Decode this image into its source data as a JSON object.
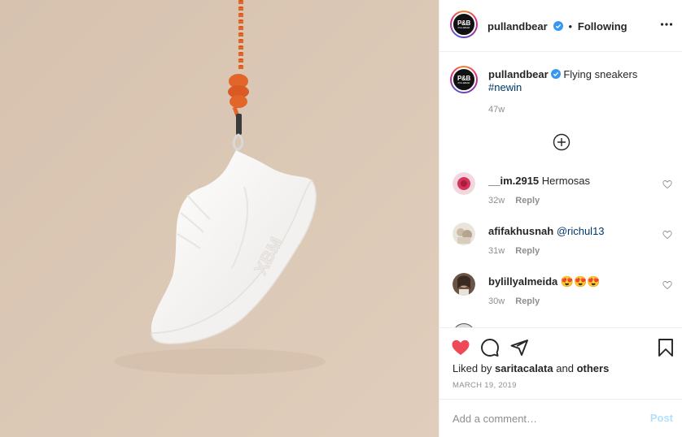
{
  "colors": {
    "photo_background": "#dcc9b7",
    "rope": "#e2662a",
    "verified_badge": "#3897f0",
    "like_heart": "#ed4956",
    "link": "#00376b",
    "muted_text": "#8e8e8e",
    "post_disabled": "#b2dffc"
  },
  "post_image": {
    "icon": "hanging-sneaker-photo"
  },
  "header": {
    "avatar_text": "P&B",
    "avatar_subtext": "PULL&BEAR",
    "username": "pullandbear",
    "separator": "•",
    "follow_status": "Following",
    "more_icon": "more-options-icon"
  },
  "caption": {
    "username": "pullandbear",
    "text": "Flying sneakers",
    "hashtag": "#newin",
    "time": "47w"
  },
  "load_more_icon": "plus-circle-icon",
  "comments": [
    {
      "username": "__im.2915",
      "text": "Hermosas",
      "time": "32w",
      "reply_label": "Reply"
    },
    {
      "username": "afifakhusnah",
      "mention": "@richul13",
      "time": "31w",
      "reply_label": "Reply"
    },
    {
      "username": "bylillyalmeida",
      "text": "😍😍😍",
      "time": "30w",
      "reply_label": "Reply"
    }
  ],
  "actions": {
    "like_icon": "heart-filled-icon",
    "comment_icon": "comment-icon",
    "share_icon": "share-icon",
    "save_icon": "bookmark-icon",
    "liked_by_prefix": "Liked by",
    "liked_by_user": "saritacalata",
    "liked_by_conj": "and",
    "liked_by_others": "others",
    "date": "MARCH 19, 2019"
  },
  "add_comment": {
    "placeholder": "Add a comment…",
    "post_label": "Post"
  }
}
